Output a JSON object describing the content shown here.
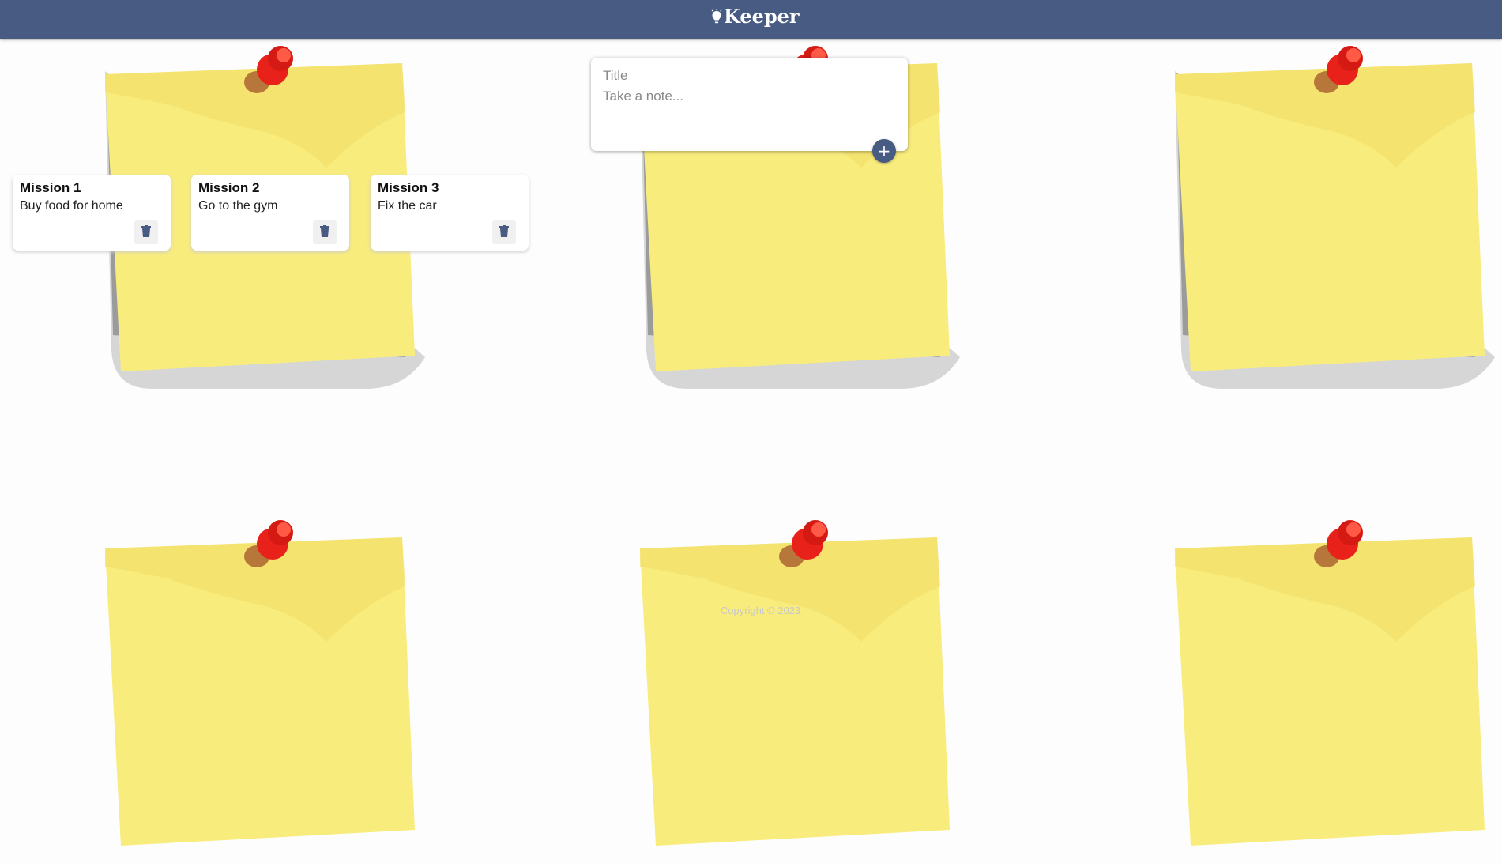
{
  "header": {
    "brand_icon": "lightbulb-icon",
    "title": "Keeper",
    "background": "#475b83"
  },
  "create_area": {
    "title_placeholder": "Title",
    "content_placeholder": "Take a note...",
    "add_icon": "plus-icon",
    "add_label": "+"
  },
  "notes": [
    {
      "title": "Mission 1",
      "content": "Buy food for home",
      "delete_icon": "trash-icon"
    },
    {
      "title": "Mission 2",
      "content": "Go to the gym",
      "delete_icon": "trash-icon"
    },
    {
      "title": "Mission 3",
      "content": "Fix the car",
      "delete_icon": "trash-icon"
    }
  ],
  "footer": {
    "copyright": "Copyright © 2023"
  },
  "colors": {
    "accent": "#475b83",
    "sticky_note": "#f8ec7d",
    "pin": "#e8211b"
  }
}
